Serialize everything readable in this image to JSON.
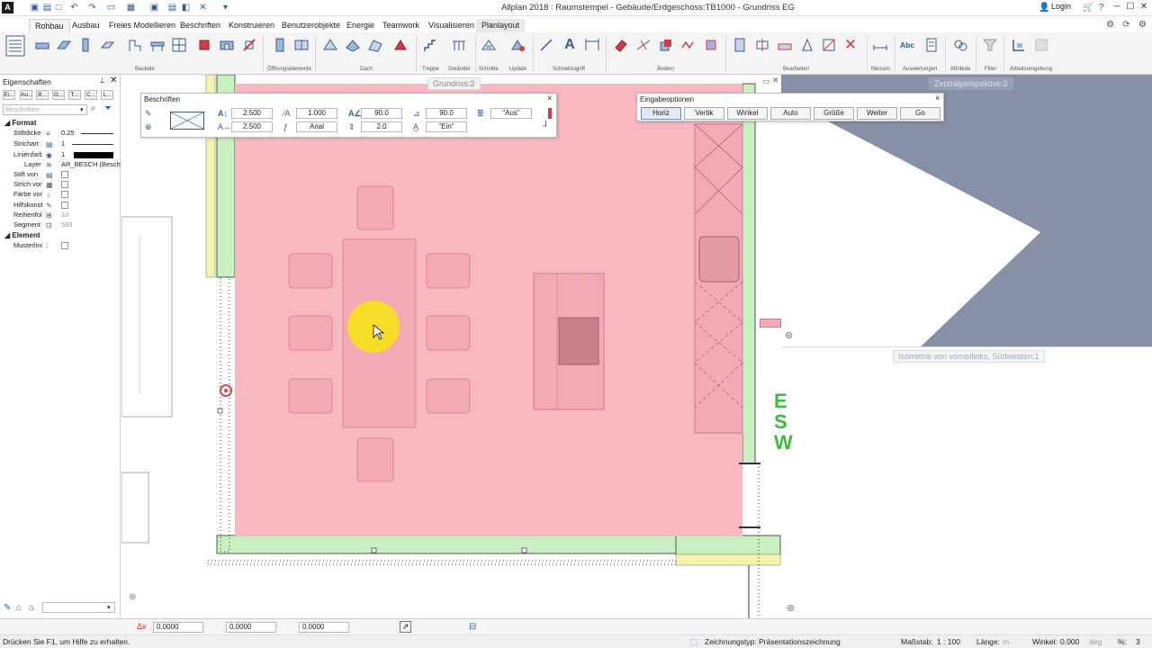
{
  "window": {
    "logo": "A",
    "title": "Allplan 2018 : Raumstempel - Gebäude/Erdgeschoss:TB1000 - Grundriss EG",
    "login": "Login"
  },
  "ribbon": {
    "tabs": [
      "Rohbau",
      "Ausbau",
      "Freies Modellieren",
      "Beschriften",
      "Konstruieren",
      "Benutzerobjekte",
      "Energie",
      "Teamwork",
      "Visualisieren",
      "Planlayout"
    ],
    "active_tab": "Rohbau",
    "groups": [
      "Bauteile",
      "Öffnungselemente",
      "Dach",
      "Treppe",
      "Geländer",
      "Schnitte",
      "Update",
      "Schnellzugriff",
      "Ändern",
      "Bearbeiten",
      "Messen",
      "Auswertungen",
      "Attribute",
      "Filter",
      "Arbeitsumgebung"
    ],
    "text_tool": "A",
    "abc_tool": "Abc"
  },
  "properties_panel": {
    "title": "Eigenschaften",
    "pin": "📌",
    "close": "✕",
    "tabs": [
      "Ei...",
      "Au...",
      "B...",
      "O...",
      "T...",
      "C...",
      "L..."
    ],
    "search_placeholder": "Beschriften",
    "categories": {
      "format": "Format",
      "element": "Element"
    },
    "rows": [
      {
        "label": "Stiftdicke",
        "value": "0.25"
      },
      {
        "label": "Strichart",
        "value": "1"
      },
      {
        "label": "Linienfarbe",
        "value": "1"
      },
      {
        "label": "Layer",
        "value": "AR_BESCH (Besch"
      },
      {
        "label": "Stift von",
        "value": ""
      },
      {
        "label": "Strich von",
        "value": ""
      },
      {
        "label": "Farbe von",
        "value": ""
      },
      {
        "label": "Hilfskonst",
        "value": ""
      },
      {
        "label": "Reihenfolge",
        "value": "10"
      },
      {
        "label": "Segment",
        "value": "583"
      }
    ],
    "element_row": {
      "label": "Musterlinie",
      "value": ""
    }
  },
  "beschriften": {
    "title": "Beschriften",
    "close": "×",
    "height": "2.500",
    "width": "2.500",
    "ratio": "1.000",
    "font": "Arial",
    "angle": "90.0",
    "spacing": "2.0",
    "italic_angle": "90.0",
    "underline": "\"Aus\"",
    "frame": "\"Ein\""
  },
  "eingabeoptionen": {
    "title": "Eingabeoptionen",
    "close": "×",
    "buttons": [
      "Horiz",
      "Vertik",
      "Winkel",
      "Auto",
      "Größe",
      "Weiter",
      "Go"
    ],
    "active": "Horiz"
  },
  "views": {
    "grundriss": "Grundriss:2",
    "zentral": "Zentralperspektive:3",
    "isometrie": "Isometrie von vorne/links, Südwesten:1"
  },
  "coords": {
    "label": "Δx",
    "x": "0.0000",
    "y": "0.0000",
    "z": "0.0000"
  },
  "status": {
    "help": "Drücken Sie F1, um Hilfe zu erhalten.",
    "drawing_type_label": "Zeichnungstyp:",
    "drawing_type": "Präsentationszeichnung",
    "scale_label": "Maßstab:",
    "scale": "1 : 100",
    "length_label": "Länge:",
    "length_unit": "m",
    "angle_label": "Winkel:",
    "angle": "0.000",
    "angle_unit": "deg",
    "percent_label": "%:",
    "percent": "3"
  },
  "colors": {
    "room_fill": "#f7b8bf",
    "wall_green": "#c8f0c0",
    "wall_yellow": "#f4f4b0",
    "cursor_highlight": "#f5e21a",
    "accent_blue": "#3a5c8c"
  },
  "icons": [
    "search-icon",
    "filter-icon",
    "close-icon",
    "pin-icon",
    "undo-icon",
    "redo-icon",
    "cart-icon",
    "help-icon"
  ]
}
